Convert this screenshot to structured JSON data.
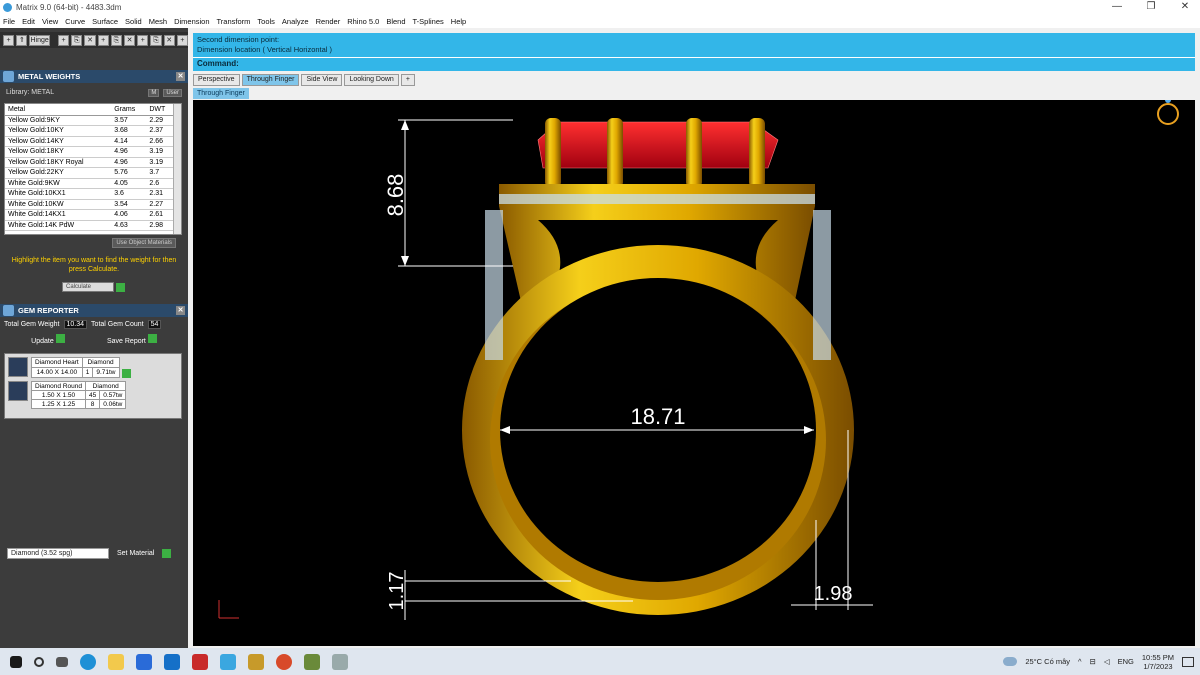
{
  "window": {
    "title": "Matrix 9.0 (64-bit) - 4483.3dm",
    "minimize": "—",
    "maximize": "❐",
    "close": "✕"
  },
  "menu": [
    "File",
    "Edit",
    "View",
    "Curve",
    "Surface",
    "Solid",
    "Mesh",
    "Dimension",
    "Transform",
    "Tools",
    "Analyze",
    "Render",
    "Rhino 5.0",
    "Blend",
    "T-Splines",
    "Help"
  ],
  "toolbar": {
    "buttons": [
      "+",
      "⇑",
      "Hinge",
      "+",
      "⎘",
      "✕",
      "+",
      "⎘",
      "✕",
      "+",
      "⎘",
      "✕",
      "+"
    ]
  },
  "metal_weights": {
    "title": "METAL WEIGHTS",
    "library_label": "Library: METAL",
    "toggle_a": "M",
    "toggle_b": "User",
    "columns": [
      "Metal",
      "Grams",
      "DWT"
    ],
    "rows": [
      [
        "Yellow Gold:9KY",
        "3.57",
        "2.29"
      ],
      [
        "Yellow Gold:10KY",
        "3.68",
        "2.37"
      ],
      [
        "Yellow Gold:14KY",
        "4.14",
        "2.66"
      ],
      [
        "Yellow Gold:18KY",
        "4.96",
        "3.19"
      ],
      [
        "Yellow Gold:18KY Royal",
        "4.96",
        "3.19"
      ],
      [
        "Yellow Gold:22KY",
        "5.76",
        "3.7"
      ],
      [
        "White Gold:9KW",
        "4.05",
        "2.6"
      ],
      [
        "White Gold:10KX1",
        "3.6",
        "2.31"
      ],
      [
        "White Gold:10KW",
        "3.54",
        "2.27"
      ],
      [
        "White Gold:14KX1",
        "4.06",
        "2.61"
      ],
      [
        "White Gold:14K PdW",
        "4.63",
        "2.98"
      ]
    ],
    "use_object_materials": "Use Object Materials",
    "hint": "Highlight the item you want to find the weight for then press Calculate.",
    "calculate": "Calculate"
  },
  "gem_reporter": {
    "title": "GEM REPORTER",
    "total_weight_label": "Total Gem Weight",
    "total_weight": "10.34",
    "total_count_label": "Total Gem Count",
    "total_count": "54",
    "update": "Update",
    "save_report": "Save Report",
    "groups": [
      {
        "shape": "Diamond Heart",
        "material": "Diamond",
        "rows": [
          [
            "14.00 X 14.00",
            "1",
            "9.71tw"
          ]
        ]
      },
      {
        "shape": "Diamond Round",
        "material": "Diamond",
        "rows": [
          [
            "1.50 X 1.50",
            "45",
            "0.57tw"
          ],
          [
            "1.25 X 1.25",
            "8",
            "0.06tw"
          ]
        ]
      }
    ],
    "material_select": "Diamond     (3.52 spg)",
    "set_material": "Set Material"
  },
  "command": {
    "line1": "Second dimension point:",
    "line2": "Dimension location ( Vertical  Horizontal )",
    "label": "Command:"
  },
  "tabs": [
    "Perspective",
    "Through Finger",
    "Side View",
    "Looking Down",
    "+"
  ],
  "active_tab": "Through Finger",
  "viewport_label": "Through Finger",
  "dimensions": {
    "height": "8.68",
    "inner_diameter": "18.71",
    "shank_thickness": "1.17",
    "shank_width": "1.98"
  },
  "taskbar": {
    "weather": "25°C  Có mây",
    "time": "10:55 PM",
    "date": "1/7/2023"
  },
  "colors": {
    "accent": "#33b6e8",
    "panel": "#3c3c3c",
    "gold": "#e8b90c",
    "ruby": "#d0101a"
  }
}
